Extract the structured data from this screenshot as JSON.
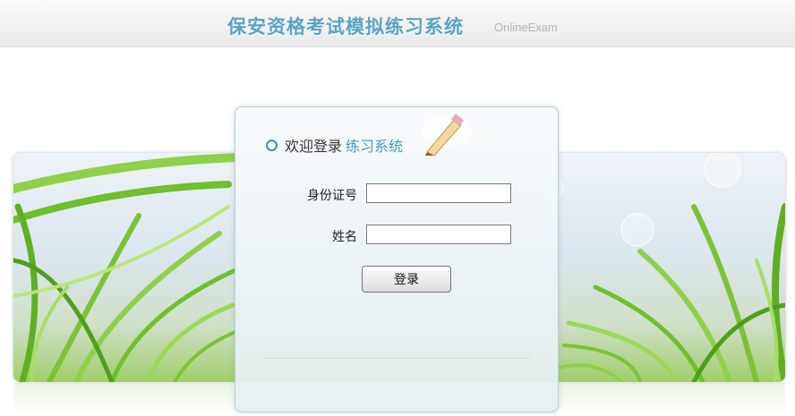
{
  "header": {
    "title": "保安资格考试模拟练习系统",
    "subtitle": "OnlineExam"
  },
  "login": {
    "welcome": "欢迎登录",
    "welcome_accent": "练习系统",
    "id_label": "身份证号",
    "id_value": "",
    "name_label": "姓名",
    "name_value": "",
    "submit_label": "登录"
  },
  "colors": {
    "accent": "#3e9bc2",
    "title": "#5aa3c4",
    "grass": "#7cc236"
  }
}
